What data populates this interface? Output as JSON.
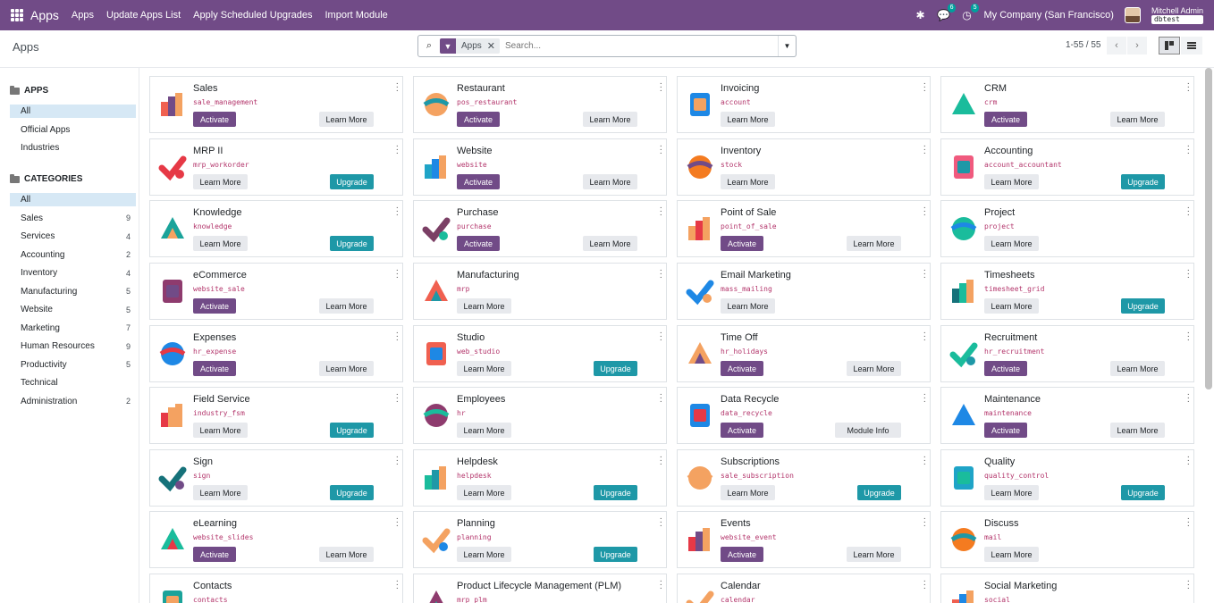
{
  "navbar": {
    "brand": "Apps",
    "menu": [
      "Apps",
      "Update Apps List",
      "Apply Scheduled Upgrades",
      "Import Module"
    ],
    "chat_count": "6",
    "activity_count": "5",
    "company": "My Company (San Francisco)",
    "user": "Mitchell Admin",
    "db": "dbtest"
  },
  "control": {
    "title": "Apps",
    "facet": "Apps",
    "search_placeholder": "Search...",
    "pager": "1-55 / 55"
  },
  "sidebar": {
    "apps_header": "APPS",
    "apps_items": [
      {
        "label": "All",
        "count": ""
      },
      {
        "label": "Official Apps",
        "count": ""
      },
      {
        "label": "Industries",
        "count": ""
      }
    ],
    "categories_header": "CATEGORIES",
    "category_items": [
      {
        "label": "All",
        "count": ""
      },
      {
        "label": "Sales",
        "count": "9"
      },
      {
        "label": "Services",
        "count": "4"
      },
      {
        "label": "Accounting",
        "count": "2"
      },
      {
        "label": "Inventory",
        "count": "4"
      },
      {
        "label": "Manufacturing",
        "count": "5"
      },
      {
        "label": "Website",
        "count": "5"
      },
      {
        "label": "Marketing",
        "count": "7"
      },
      {
        "label": "Human Resources",
        "count": "9"
      },
      {
        "label": "Productivity",
        "count": "5"
      },
      {
        "label": "Technical",
        "count": ""
      },
      {
        "label": "Administration",
        "count": "2"
      }
    ]
  },
  "apps": [
    {
      "name": "Sales",
      "tech": "sale_management",
      "left": "Activate",
      "right": "Learn More",
      "icon": "sales-icon",
      "color": "#f06050"
    },
    {
      "name": "Restaurant",
      "tech": "pos_restaurant",
      "left": "Activate",
      "right": "Learn More",
      "icon": "restaurant-icon",
      "color": "#f4a261"
    },
    {
      "name": "Invoicing",
      "tech": "account",
      "left": "Learn More",
      "right": "",
      "icon": "invoicing-icon",
      "color": "#1e88e5"
    },
    {
      "name": "CRM",
      "tech": "crm",
      "left": "Activate",
      "right": "Learn More",
      "icon": "crm-icon",
      "color": "#1abc9c"
    },
    {
      "name": "MRP II",
      "tech": "mrp_workorder",
      "left": "Learn More",
      "right": "Upgrade",
      "icon": "mrp-icon",
      "color": "#e63946"
    },
    {
      "name": "Website",
      "tech": "website",
      "left": "Activate",
      "right": "Learn More",
      "icon": "website-icon",
      "color": "#1fa4c7"
    },
    {
      "name": "Inventory",
      "tech": "stock",
      "left": "Learn More",
      "right": "",
      "icon": "inventory-icon",
      "color": "#f47b20"
    },
    {
      "name": "Accounting",
      "tech": "account_accountant",
      "left": "Learn More",
      "right": "Upgrade",
      "icon": "accounting-icon",
      "color": "#f05a7e"
    },
    {
      "name": "Knowledge",
      "tech": "knowledge",
      "left": "Learn More",
      "right": "Upgrade",
      "icon": "knowledge-icon",
      "color": "#1aa39a"
    },
    {
      "name": "Purchase",
      "tech": "purchase",
      "left": "Activate",
      "right": "Learn More",
      "icon": "purchase-icon",
      "color": "#7b3f65"
    },
    {
      "name": "Point of Sale",
      "tech": "point_of_sale",
      "left": "Activate",
      "right": "Learn More",
      "icon": "pos-icon",
      "color": "#f4a261"
    },
    {
      "name": "Project",
      "tech": "project",
      "left": "Learn More",
      "right": "",
      "icon": "project-icon",
      "color": "#1abc9c"
    },
    {
      "name": "eCommerce",
      "tech": "website_sale",
      "left": "Activate",
      "right": "Learn More",
      "icon": "ecommerce-icon",
      "color": "#8e3b6e"
    },
    {
      "name": "Manufacturing",
      "tech": "mrp",
      "left": "Learn More",
      "right": "",
      "icon": "manufacturing-icon",
      "color": "#f06050"
    },
    {
      "name": "Email Marketing",
      "tech": "mass_mailing",
      "left": "Learn More",
      "right": "",
      "icon": "email-marketing-icon",
      "color": "#1e88e5"
    },
    {
      "name": "Timesheets",
      "tech": "timesheet_grid",
      "left": "Learn More",
      "right": "Upgrade",
      "icon": "timesheets-icon",
      "color": "#16727a"
    },
    {
      "name": "Expenses",
      "tech": "hr_expense",
      "left": "Activate",
      "right": "Learn More",
      "icon": "expenses-icon",
      "color": "#1e88e5"
    },
    {
      "name": "Studio",
      "tech": "web_studio",
      "left": "Learn More",
      "right": "Upgrade",
      "icon": "studio-icon",
      "color": "#f06050"
    },
    {
      "name": "Time Off",
      "tech": "hr_holidays",
      "left": "Activate",
      "right": "Learn More",
      "icon": "time-off-icon",
      "color": "#f4a261"
    },
    {
      "name": "Recruitment",
      "tech": "hr_recruitment",
      "left": "Activate",
      "right": "Learn More",
      "icon": "recruitment-icon",
      "color": "#1abc9c"
    },
    {
      "name": "Field Service",
      "tech": "industry_fsm",
      "left": "Learn More",
      "right": "Upgrade",
      "icon": "field-service-icon",
      "color": "#e63946"
    },
    {
      "name": "Employees",
      "tech": "hr",
      "left": "Learn More",
      "right": "",
      "icon": "employees-icon",
      "color": "#8e3b6e"
    },
    {
      "name": "Data Recycle",
      "tech": "data_recycle",
      "left": "Activate",
      "right": "Module Info",
      "icon": "data-recycle-icon",
      "color": "#1e88e5"
    },
    {
      "name": "Maintenance",
      "tech": "maintenance",
      "left": "Activate",
      "right": "Learn More",
      "icon": "maintenance-icon",
      "color": "#1e88e5"
    },
    {
      "name": "Sign",
      "tech": "sign",
      "left": "Learn More",
      "right": "Upgrade",
      "icon": "sign-icon",
      "color": "#16727a"
    },
    {
      "name": "Helpdesk",
      "tech": "helpdesk",
      "left": "Learn More",
      "right": "Upgrade",
      "icon": "helpdesk-icon",
      "color": "#1abc9c"
    },
    {
      "name": "Subscriptions",
      "tech": "sale_subscription",
      "left": "Learn More",
      "right": "Upgrade",
      "icon": "subscriptions-icon",
      "color": "#f4a261"
    },
    {
      "name": "Quality",
      "tech": "quality_control",
      "left": "Learn More",
      "right": "Upgrade",
      "icon": "quality-icon",
      "color": "#1fa4c7"
    },
    {
      "name": "eLearning",
      "tech": "website_slides",
      "left": "Activate",
      "right": "Learn More",
      "icon": "elearning-icon",
      "color": "#1abc9c"
    },
    {
      "name": "Planning",
      "tech": "planning",
      "left": "Learn More",
      "right": "Upgrade",
      "icon": "planning-icon",
      "color": "#f4a261"
    },
    {
      "name": "Events",
      "tech": "website_event",
      "left": "Activate",
      "right": "Learn More",
      "icon": "events-icon",
      "color": "#e63946"
    },
    {
      "name": "Discuss",
      "tech": "mail",
      "left": "Learn More",
      "right": "",
      "icon": "discuss-icon",
      "color": "#f47b20"
    },
    {
      "name": "Contacts",
      "tech": "contacts",
      "left": "",
      "right": "",
      "icon": "contacts-icon",
      "color": "#1aa39a"
    },
    {
      "name": "Product Lifecycle Management (PLM)",
      "tech": "mrp_plm",
      "left": "",
      "right": "",
      "icon": "plm-icon",
      "color": "#8e3b6e"
    },
    {
      "name": "Calendar",
      "tech": "calendar",
      "left": "",
      "right": "",
      "icon": "calendar-icon",
      "color": "#f4a261"
    },
    {
      "name": "Social Marketing",
      "tech": "social",
      "left": "",
      "right": "",
      "icon": "social-marketing-icon",
      "color": "#f06050"
    }
  ]
}
